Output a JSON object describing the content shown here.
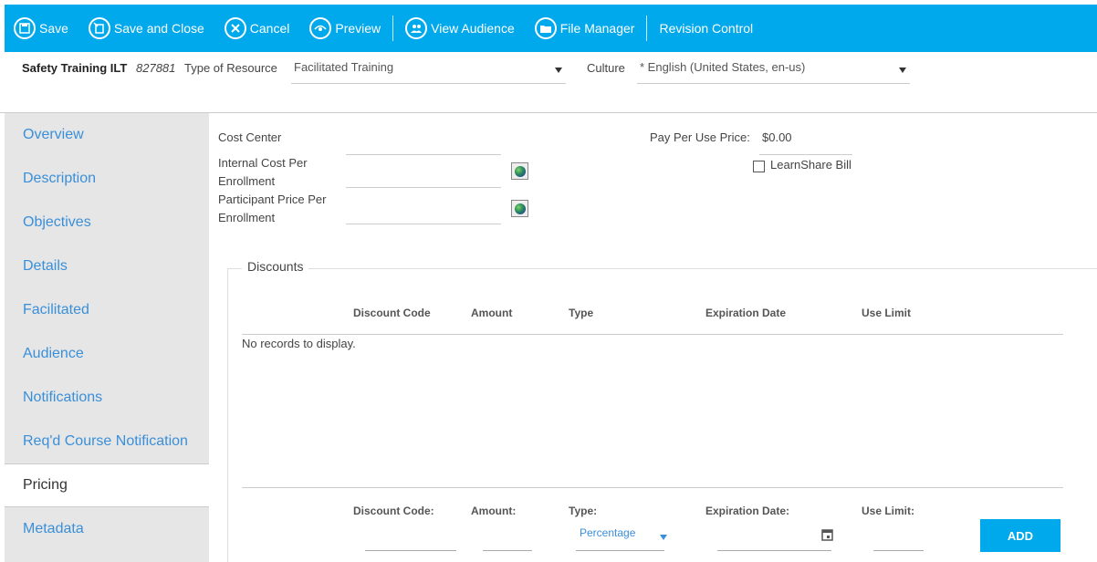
{
  "toolbar": {
    "save": "Save",
    "save_close": "Save and Close",
    "cancel": "Cancel",
    "preview": "Preview",
    "view_audience": "View Audience",
    "file_manager": "File Manager",
    "revision_control": "Revision Control",
    "bg_color": "#00a8ec"
  },
  "header": {
    "course_title": "Safety Training ILT",
    "course_id": "827881",
    "type_label": "Type of Resource",
    "type_value": "Facilitated Training",
    "culture_label": "Culture",
    "culture_value": "* English (United States, en-us)"
  },
  "sidebar": {
    "items": [
      {
        "label": "Overview"
      },
      {
        "label": "Description"
      },
      {
        "label": "Objectives"
      },
      {
        "label": "Details"
      },
      {
        "label": "Facilitated"
      },
      {
        "label": "Audience"
      },
      {
        "label": "Notifications"
      },
      {
        "label": "Req'd Course Notification"
      },
      {
        "label": "Pricing",
        "active": true
      },
      {
        "label": "Metadata"
      }
    ]
  },
  "pricing": {
    "cost_center_label": "Cost Center",
    "cost_center_value": "",
    "internal_cost_label_1": "Internal Cost Per",
    "internal_cost_label_2": "Enrollment",
    "internal_cost_value": "",
    "participant_price_label_1": "Participant Price Per",
    "participant_price_label_2": "Enrollment",
    "participant_price_value": "",
    "pay_per_use_label": "Pay Per Use Price:",
    "pay_per_use_value": "$0.00",
    "learnshare_bill_label": "LearnShare Bill",
    "learnshare_bill_checked": false
  },
  "discounts": {
    "legend": "Discounts",
    "columns": [
      "Discount Code",
      "Amount",
      "Type",
      "Expiration Date",
      "Use Limit"
    ],
    "rows": [],
    "empty_message": "No records to display.",
    "form": {
      "code_label": "Discount Code:",
      "amount_label": "Amount:",
      "type_label": "Type:",
      "type_value": "Percentage",
      "expiration_label": "Expiration Date:",
      "use_limit_label": "Use Limit:",
      "add_button": "ADD"
    }
  }
}
